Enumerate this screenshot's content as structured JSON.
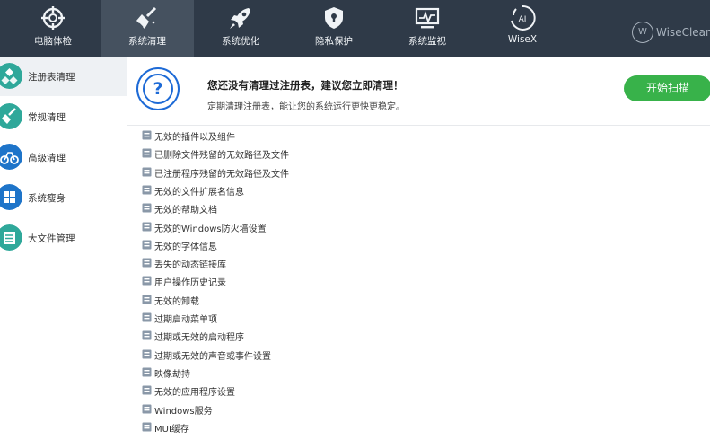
{
  "colors": {
    "topbar": "#2f3a48",
    "topbar_active": "#45515f",
    "accent_blue": "#1d6ad6",
    "scan_green": "#38b24a",
    "side_teal": "#2fa89a"
  },
  "top_tabs": [
    {
      "label": "电脑体检",
      "icon": "crosshair-icon"
    },
    {
      "label": "系统清理",
      "icon": "broom-icon"
    },
    {
      "label": "系统优化",
      "icon": "rocket-icon"
    },
    {
      "label": "隐私保护",
      "icon": "shield-lock-icon"
    },
    {
      "label": "系统监视",
      "icon": "monitor-icon"
    },
    {
      "label": "WiseX",
      "icon": "wisex-icon"
    }
  ],
  "brand": {
    "logo_letter": "W",
    "text": "WiseCleaner"
  },
  "sidebar": [
    {
      "label": "注册表清理",
      "icon": "registry-icon"
    },
    {
      "label": "常规清理",
      "icon": "broom-icon"
    },
    {
      "label": "高级清理",
      "icon": "bike-icon"
    },
    {
      "label": "系统瘦身",
      "icon": "windows-icon"
    },
    {
      "label": "大文件管理",
      "icon": "folder-icon"
    }
  ],
  "header": {
    "icon": "question-icon",
    "question_mark": "?",
    "title": "您还没有清理过注册表，建议您立即清理！",
    "subtitle": "定期清理注册表，能让您的系统运行更快更稳定。",
    "scan_button": "开始扫描"
  },
  "list_items": [
    "无效的插件以及组件",
    "已删除文件残留的无效路径及文件",
    "已注册程序残留的无效路径及文件",
    "无效的文件扩展名信息",
    "无效的帮助文档",
    "无效的Windows防火墙设置",
    "无效的字体信息",
    "丢失的动态链接库",
    "用户操作历史记录",
    "无效的卸载",
    "过期启动菜单项",
    "过期或无效的启动程序",
    "过期或无效的声音或事件设置",
    "映像劫持",
    "无效的应用程序设置",
    "Windows服务",
    "MUI缓存"
  ]
}
